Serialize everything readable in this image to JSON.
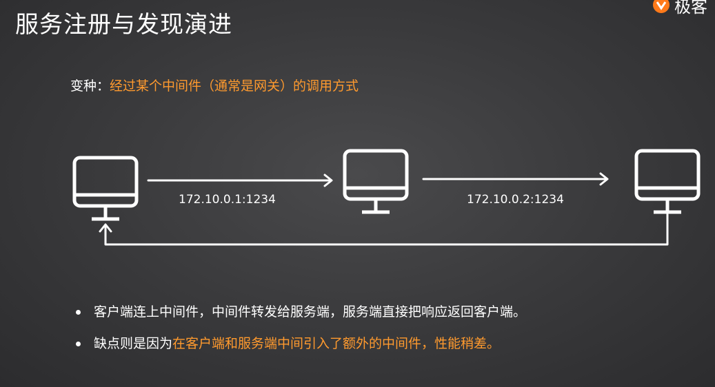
{
  "slide": {
    "title": "服务注册与发现演进",
    "logo_text": "极客",
    "subtitle_prefix": "变种：",
    "subtitle_highlight": "经过某个中间件（通常是网关）的调用方式"
  },
  "diagram": {
    "hops": [
      {
        "address": "172.10.0.1:1234"
      },
      {
        "address": "172.10.0.2:1234"
      }
    ],
    "icons": [
      "monitor-icon",
      "monitor-icon",
      "monitor-icon"
    ]
  },
  "bullets": [
    {
      "text": "客户端连上中间件，中间件转发给服务端，服务端直接把响应返回客户端。",
      "highlight": ""
    },
    {
      "text": "缺点则是因为",
      "highlight": "在客户端和服务端中间引入了额外的中间件，性能稍差。"
    }
  ],
  "colors": {
    "accent": "#ff9a2e",
    "text": "#ffffff",
    "background": "#3a3a3c"
  }
}
